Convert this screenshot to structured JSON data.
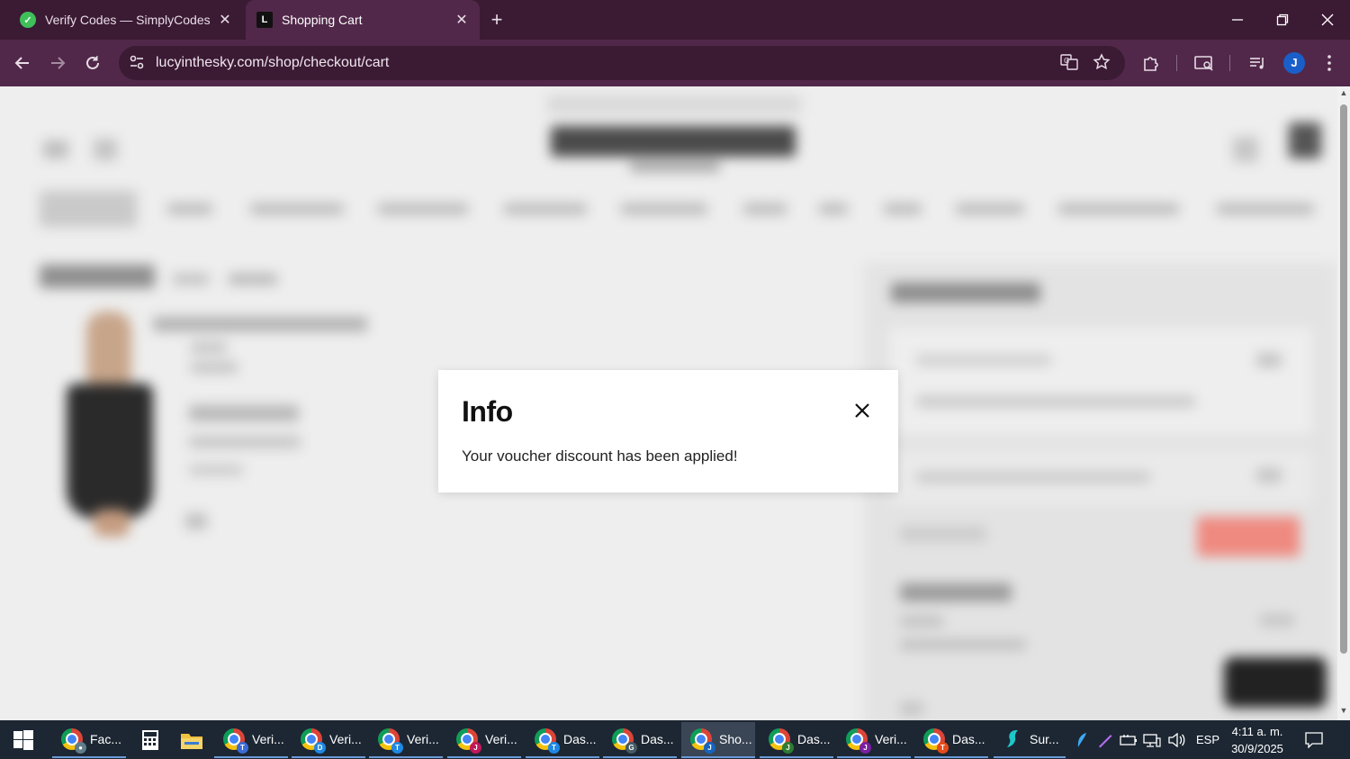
{
  "browser": {
    "tabs": [
      {
        "title": "Verify Codes — SimplyCodes",
        "icon": "simplycodes-check-icon"
      },
      {
        "title": "Shopping Cart",
        "icon": "lucy-in-the-sky-l-icon"
      }
    ],
    "close_glyph": "✕",
    "new_tab_glyph": "+",
    "url": "lucyinthesky.com/shop/checkout/cart",
    "profile_initial": "J",
    "colors": {
      "tabbar": "#3b1a34",
      "toolbar": "#51284a",
      "profile": "#1a5fc9"
    }
  },
  "modal": {
    "title": "Info",
    "message": "Your voucher discount has been applied!"
  },
  "taskbar": {
    "items": [
      {
        "label": "Fac...",
        "badge": ""
      },
      {
        "label": "",
        "icon": "calculator-icon"
      },
      {
        "label": "",
        "icon": "file-explorer-icon"
      },
      {
        "label": "Veri...",
        "badge": "T",
        "badge_color": "#3b6bd6"
      },
      {
        "label": "Veri...",
        "badge": "D",
        "badge_color": "#1e88e5"
      },
      {
        "label": "Veri...",
        "badge": "T",
        "badge_color": "#1e88e5"
      },
      {
        "label": "Veri...",
        "badge": "J",
        "badge_color": "#c2185b"
      },
      {
        "label": "Das...",
        "badge": "T",
        "badge_color": "#1e88e5"
      },
      {
        "label": "Das...",
        "badge": "G",
        "badge_color": "#455a64"
      },
      {
        "label": "Sho...",
        "badge": "J",
        "badge_color": "#1565c0"
      },
      {
        "label": "Das...",
        "badge": "J",
        "badge_color": "#2e7d32"
      },
      {
        "label": "Veri...",
        "badge": "J",
        "badge_color": "#7b1fa2"
      },
      {
        "label": "Das...",
        "badge": "T",
        "badge_color": "#e64a19"
      },
      {
        "label": "Sur...",
        "icon": "surfshark-icon"
      }
    ],
    "language": "ESP",
    "time": "4:11 a. m.",
    "date": "30/9/2025"
  }
}
